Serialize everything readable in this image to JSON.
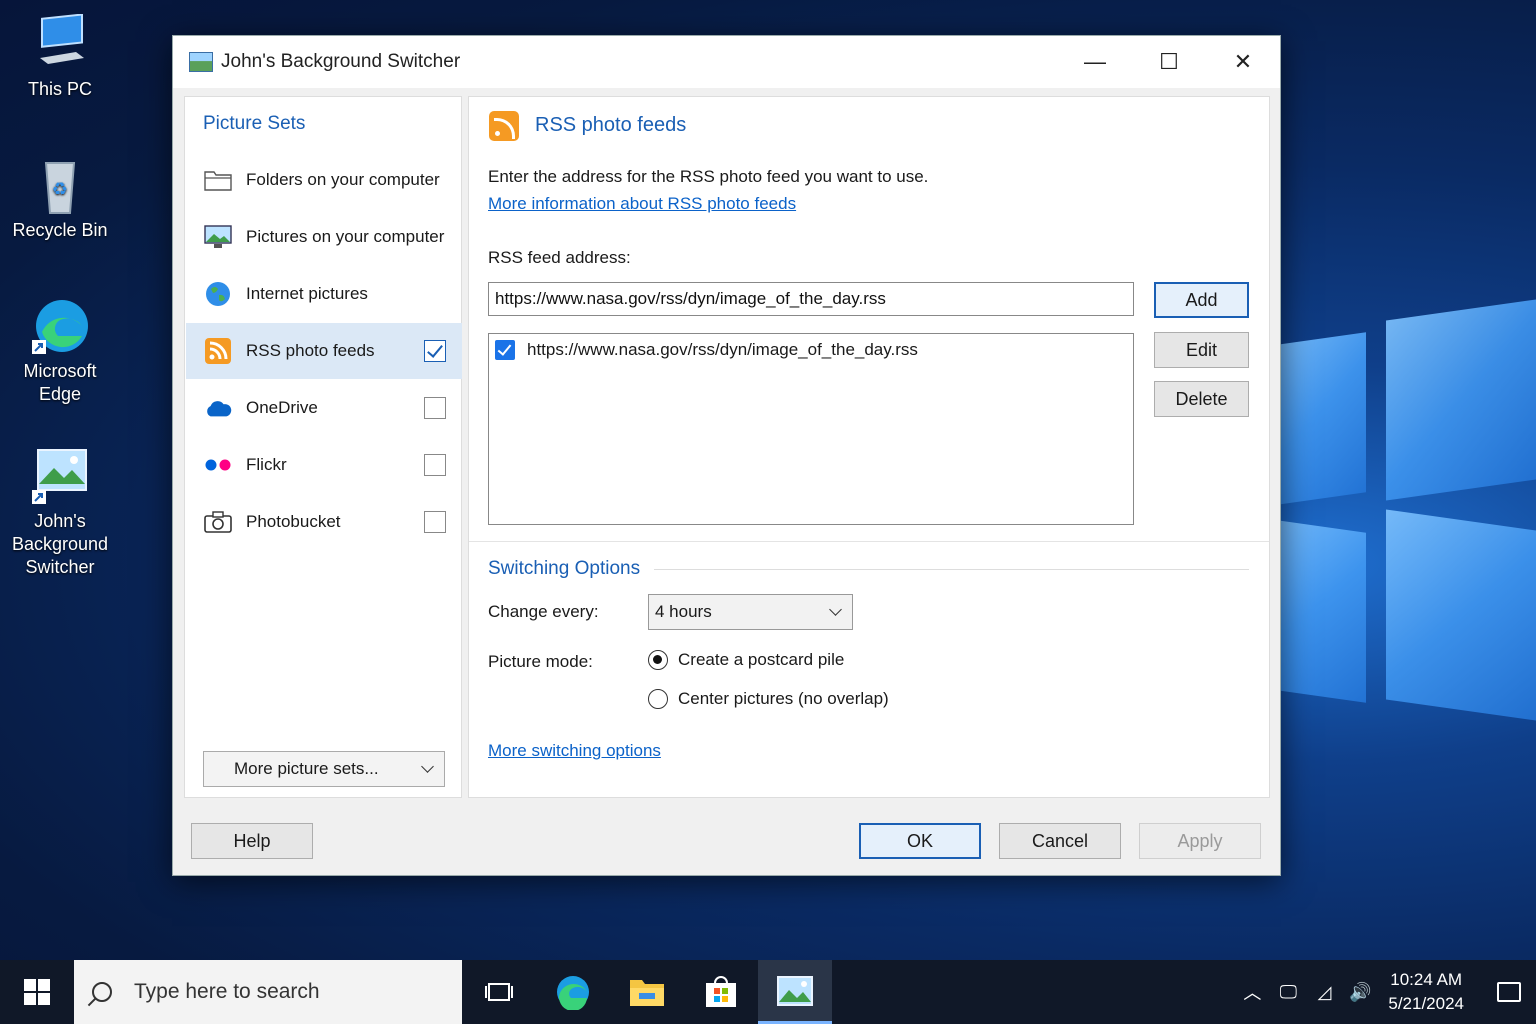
{
  "desktop": {
    "icons": [
      {
        "label": "This PC"
      },
      {
        "label": "Recycle Bin"
      },
      {
        "label": "Microsoft Edge"
      },
      {
        "label": "John's Background Switcher"
      }
    ]
  },
  "window": {
    "title": "John's Background Switcher",
    "controls": {
      "minimize": "—",
      "maximize": "☐",
      "close": "✕"
    }
  },
  "picture_sets": {
    "heading": "Picture Sets",
    "items": [
      {
        "label": "Folders on your computer"
      },
      {
        "label": "Pictures on your computer"
      },
      {
        "label": "Internet pictures"
      },
      {
        "label": "RSS photo feeds",
        "checked": true
      },
      {
        "label": "OneDrive",
        "checked": false
      },
      {
        "label": "Flickr",
        "checked": false
      },
      {
        "label": "Photobucket",
        "checked": false
      }
    ],
    "more_button": "More picture sets..."
  },
  "rss": {
    "title": "RSS photo feeds",
    "description": "Enter the address for the RSS photo feed you want to use.",
    "info_link": "More information about RSS photo feeds",
    "address_label": "RSS feed address:",
    "address_value": "https://www.nasa.gov/rss/dyn/image_of_the_day.rss",
    "buttons": {
      "add": "Add",
      "edit": "Edit",
      "delete": "Delete"
    },
    "feeds": [
      {
        "url": "https://www.nasa.gov/rss/dyn/image_of_the_day.rss",
        "checked": true
      }
    ]
  },
  "switching": {
    "title": "Switching Options",
    "change_label": "Change every:",
    "change_value": "4 hours",
    "mode_label": "Picture mode:",
    "modes": [
      {
        "label": "Create a postcard pile",
        "selected": true
      },
      {
        "label": "Center pictures (no overlap)",
        "selected": false
      }
    ],
    "more_link": "More switching options"
  },
  "footer": {
    "help": "Help",
    "ok": "OK",
    "cancel": "Cancel",
    "apply": "Apply"
  },
  "taskbar": {
    "search_placeholder": "Type here to search",
    "time": "10:24 AM",
    "date": "5/21/2024"
  },
  "colors": {
    "accent": "#1a5fb4",
    "link": "#0b62c9",
    "rss": "#f59a23"
  }
}
